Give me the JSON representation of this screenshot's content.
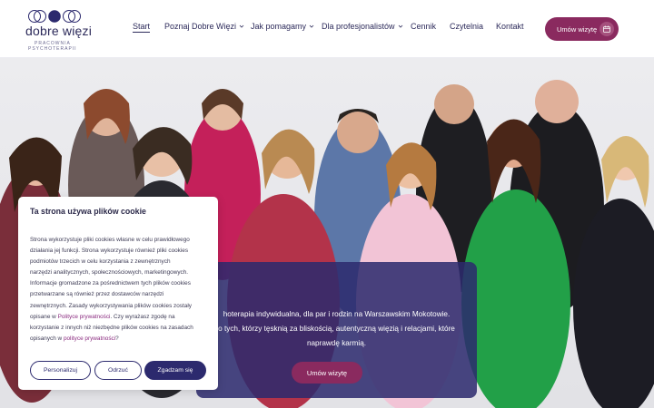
{
  "logo": {
    "title": "dobre więzi",
    "sub_line1": "PRACOWNIA",
    "sub_line2": "PSYCHOTERAPII"
  },
  "nav": [
    {
      "label": "Start",
      "active": true,
      "dropdown": false
    },
    {
      "label": "Poznaj Dobre Więzi",
      "active": false,
      "dropdown": true
    },
    {
      "label": "Jak pomagamy",
      "active": false,
      "dropdown": true
    },
    {
      "label": "Dla profesjonalistów",
      "active": false,
      "dropdown": true
    },
    {
      "label": "Cennik",
      "active": false,
      "dropdown": false
    },
    {
      "label": "Czytelnia",
      "active": false,
      "dropdown": false
    },
    {
      "label": "Kontakt",
      "active": false,
      "dropdown": false
    }
  ],
  "header_cta": {
    "label": "Umów wizytę",
    "icon": "calendar-icon"
  },
  "hero": {
    "line1": "hoterapia indywidualna, dla par i rodzin na Warszawskim Mokotowie.",
    "line2": "o tych, którzy tęsknią za bliskością, autentyczną więzią i relacjami, które",
    "line3": "naprawdę karmią.",
    "cta_label": "Umów wizytę"
  },
  "cookie": {
    "title": "Ta strona używa plików cookie",
    "lines": [
      [
        "Strona wykorzystuje pliki cookies własne w celu prawidłowego"
      ],
      [
        "działania jej funkcji. Strona wykorzystuje również pliki cookies"
      ],
      [
        "podmiotów trzecich w celu korzystania z zewnętrznych"
      ],
      [
        "narzędzi analitycznych, społecznościowych, marketingowych."
      ],
      [
        "Informacje gromadzone za pośrednictwem tych plików cookies"
      ],
      [
        "przetwarzane są również przez dostawców narzędzi"
      ],
      [
        "zewnętrznych. Zasady wykorzystywania plików cookies zostały"
      ],
      [
        "opisane w ",
        "Polityce prywatności",
        ". Czy wyrażasz zgodę na"
      ],
      [
        "korzystanie z innych niż niezbędne plików cookies na zasadach"
      ],
      [
        "opisanych w ",
        "polityce prywatności",
        "?"
      ]
    ],
    "buttons": {
      "customize": "Personalizuj",
      "reject": "Odrzuć",
      "accept": "Zgadzam się"
    }
  },
  "colors": {
    "brand_navy": "#2c2a6e",
    "brand_plum": "#8a2a5f"
  }
}
